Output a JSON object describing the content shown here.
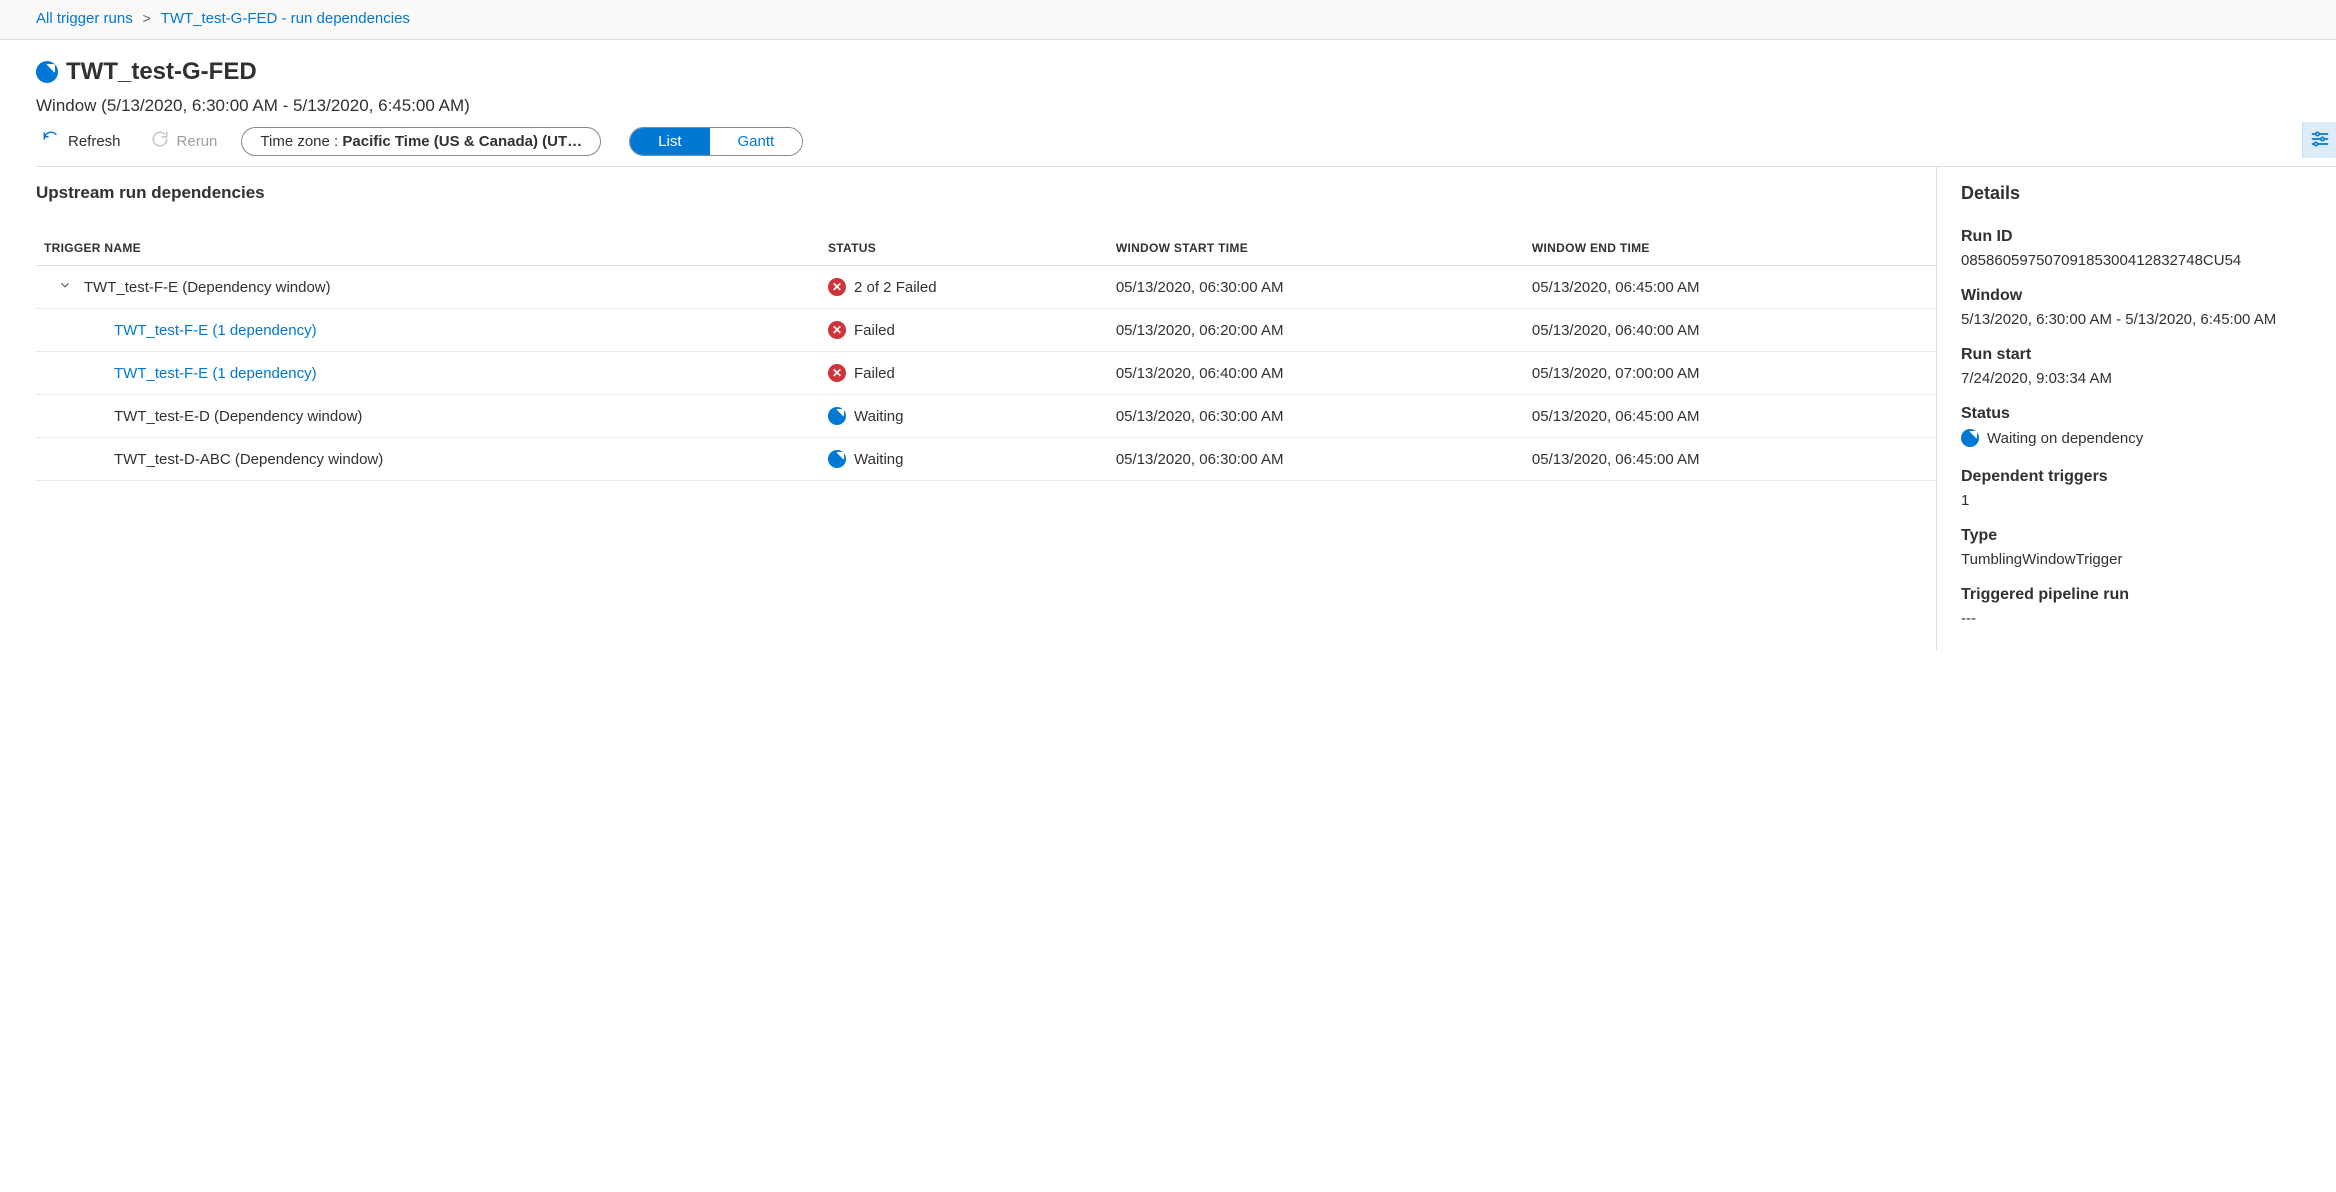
{
  "breadcrumb": {
    "item1": "All trigger runs",
    "item2": "TWT_test-G-FED - run dependencies"
  },
  "header": {
    "title": "TWT_test-G-FED",
    "window_text": "Window (5/13/2020, 6:30:00 AM - 5/13/2020, 6:45:00 AM)",
    "refresh_label": "Refresh",
    "rerun_label": "Rerun",
    "tz_label_prefix": "Time zone : ",
    "tz_value": "Pacific Time (US & Canada) (UT…",
    "view_list": "List",
    "view_gantt": "Gantt"
  },
  "upstream": {
    "heading": "Upstream run dependencies",
    "col_trigger": "TRIGGER NAME",
    "col_status": "STATUS",
    "col_start": "WINDOW START TIME",
    "col_end": "WINDOW END TIME",
    "rows": [
      {
        "indent": 1,
        "expandable": true,
        "name": "TWT_test-F-E (Dependency window)",
        "link": false,
        "status_icon": "fail",
        "status_text": "2 of 2 Failed",
        "start": "05/13/2020, 06:30:00 AM",
        "end": "05/13/2020, 06:45:00 AM"
      },
      {
        "indent": 2,
        "expandable": false,
        "name": "TWT_test-F-E (1 dependency)",
        "link": true,
        "status_icon": "fail",
        "status_text": "Failed",
        "start": "05/13/2020, 06:20:00 AM",
        "end": "05/13/2020, 06:40:00 AM"
      },
      {
        "indent": 2,
        "expandable": false,
        "name": "TWT_test-F-E (1 dependency)",
        "link": true,
        "status_icon": "fail",
        "status_text": "Failed",
        "start": "05/13/2020, 06:40:00 AM",
        "end": "05/13/2020, 07:00:00 AM"
      },
      {
        "indent": 2,
        "expandable": false,
        "name": "TWT_test-E-D (Dependency window)",
        "link": false,
        "status_icon": "waiting",
        "status_text": "Waiting",
        "start": "05/13/2020, 06:30:00 AM",
        "end": "05/13/2020, 06:45:00 AM"
      },
      {
        "indent": 2,
        "expandable": false,
        "name": "TWT_test-D-ABC (Dependency window)",
        "link": false,
        "status_icon": "waiting",
        "status_text": "Waiting",
        "start": "05/13/2020, 06:30:00 AM",
        "end": "05/13/2020, 06:45:00 AM"
      }
    ]
  },
  "details": {
    "heading": "Details",
    "labels": {
      "run_id": "Run ID",
      "window": "Window",
      "run_start": "Run start",
      "status": "Status",
      "dependent_triggers": "Dependent triggers",
      "type": "Type",
      "triggered_pipeline": "Triggered pipeline run"
    },
    "values": {
      "run_id": "08586059750709185300412832748CU54",
      "window": "5/13/2020, 6:30:00 AM - 5/13/2020, 6:45:00 AM",
      "run_start": "7/24/2020, 9:03:34 AM",
      "status": "Waiting on dependency",
      "dependent_triggers": "1",
      "type": "TumblingWindowTrigger",
      "triggered_pipeline": "---"
    }
  }
}
